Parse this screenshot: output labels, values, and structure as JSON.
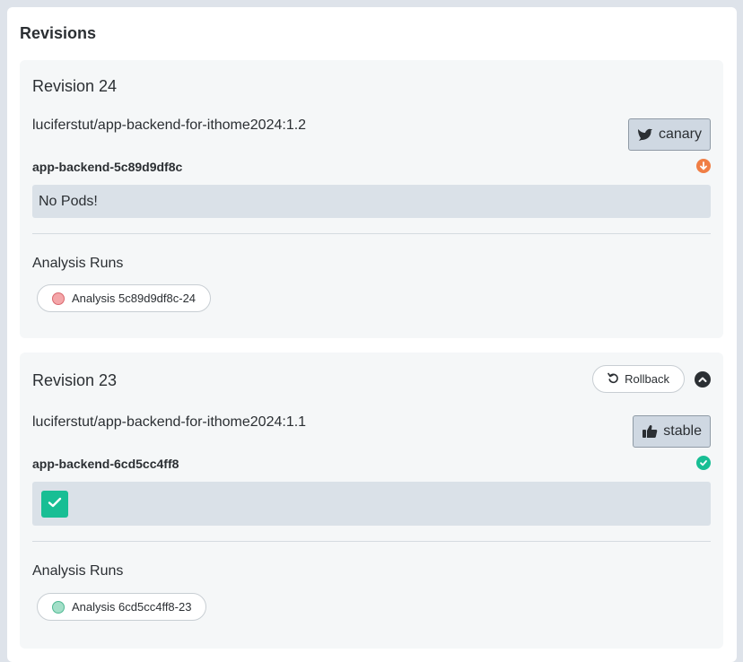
{
  "panel": {
    "title": "Revisions"
  },
  "revisions": [
    {
      "title": "Revision 24",
      "image": "luciferstut/app-backend-for-ithome2024:1.2",
      "tag": {
        "label": "canary",
        "icon": "canary-bird-icon"
      },
      "replicaset": {
        "name": "app-backend-5c89d9df8c",
        "status": "scaled-down",
        "status_color": "#f07e45"
      },
      "pods": {
        "empty_text": "No Pods!"
      },
      "analysis": {
        "title": "Analysis Runs",
        "run_label": "Analysis 5c89d9df8c-24",
        "dot_color": "#f4a6a9"
      }
    },
    {
      "title": "Revision 23",
      "image": "luciferstut/app-backend-for-ithome2024:1.1",
      "tag": {
        "label": "stable",
        "icon": "thumbs-up-icon"
      },
      "rollback_label": "Rollback",
      "replicaset": {
        "name": "app-backend-6cd5cc4ff8",
        "status": "healthy",
        "status_color": "#18be94"
      },
      "pods": {
        "count": 1,
        "pod_color": "#18be94"
      },
      "analysis": {
        "title": "Analysis Runs",
        "run_label": "Analysis 6cd5cc4ff8-23",
        "dot_color": "#a3dfc8"
      }
    }
  ]
}
